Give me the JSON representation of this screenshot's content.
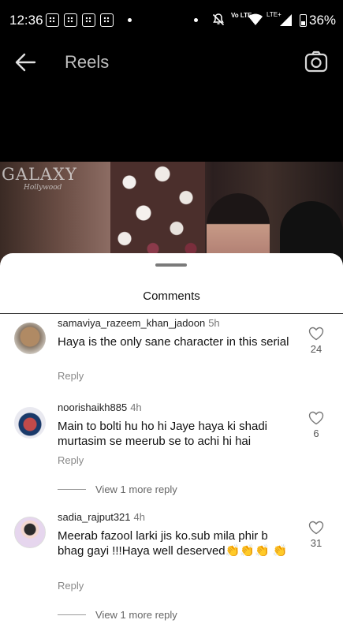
{
  "status_bar": {
    "time": "12:36",
    "volte": "Vo LTE",
    "lte": "LTE+",
    "battery": "36%"
  },
  "header": {
    "title": "Reels"
  },
  "video": {
    "watermark": "GALAXY",
    "watermark_sub": "Hollywood"
  },
  "comments_sheet": {
    "title": "Comments",
    "comments": [
      {
        "username": "samaviya_razeem_khan_jadoon",
        "time": "5h",
        "text": "Haya is the only sane character in this serial",
        "reply_label": "Reply",
        "likes": "24"
      },
      {
        "username": "noorishaikh885",
        "time": "4h",
        "text": "Main to bolti hu ho hi Jaye haya ki shadi murtasim se meerub se to achi hi hai",
        "reply_label": "Reply",
        "likes": "6",
        "view_more": "View 1 more reply"
      },
      {
        "username": "sadia_rajput321",
        "time": "4h",
        "text": "Meerab fazool larki jis ko.sub mila phir b bhag gayi !!!Haya well deserved👏👏👏 👏",
        "reply_label": "Reply",
        "likes": "31",
        "view_more": "View 1 more reply"
      }
    ]
  }
}
